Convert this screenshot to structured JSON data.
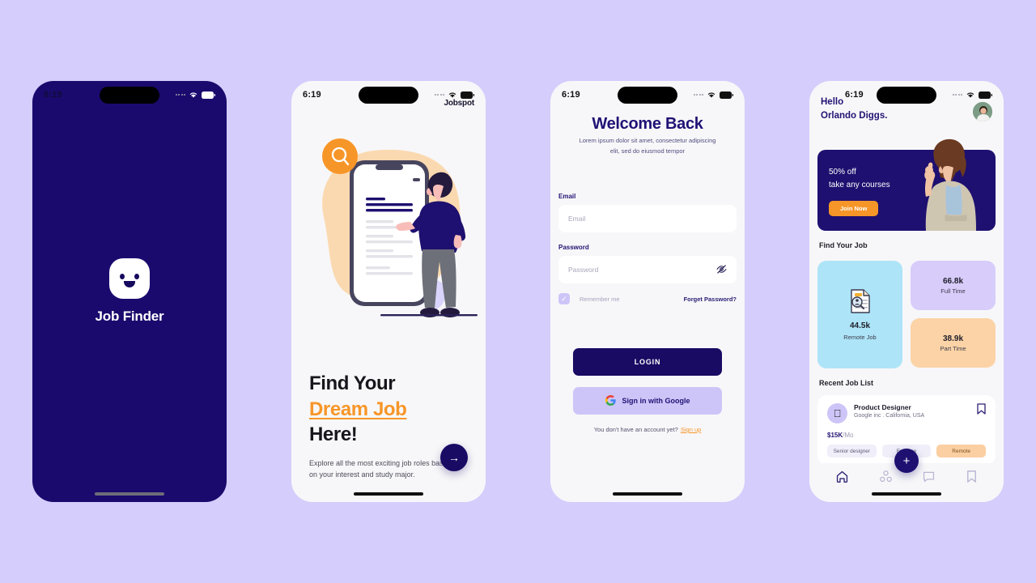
{
  "theme": {
    "page_bg": "#d5cdfb",
    "navy": "#190a64",
    "indigo": "#1e1070",
    "orange": "#f79628",
    "lavender": "#cdc5f7",
    "cyan": "#aee4f7",
    "peach": "#fbd3a6"
  },
  "splash": {
    "status_time": "6:19",
    "app_name": "Job Finder"
  },
  "onboarding": {
    "status_time": "6:19",
    "brand": "Jobspot",
    "heading_line1": "Find Your",
    "heading_accent": "Dream Job",
    "heading_line3": "Here!",
    "subtitle": "Explore all the most exciting job roles based on your interest and study major.",
    "next_label": "→"
  },
  "login": {
    "status_time": "6:19",
    "title": "Welcome Back",
    "subtitle": "Lorem ipsum dolor sit amet, consectetur adipiscing elit, sed do eiusmod tempor",
    "email_label": "Email",
    "email_placeholder": "Email",
    "email_value": "",
    "password_label": "Password",
    "password_placeholder": "Password",
    "password_value": "",
    "eye_icon": "eye-off-icon",
    "remember_label": "Remember me",
    "remember_checked": true,
    "forgot_label": "Forget Password?",
    "login_button": "LOGIN",
    "google_button": "Sign in with Google",
    "signup_prompt": "You don't have an account yet?",
    "signup_link": "Sign up"
  },
  "home": {
    "status_time": "6:19",
    "greeting": "Hello",
    "user_name": "Orlando Diggs.",
    "avatar": "user-avatar",
    "banner": {
      "line1": "50% off",
      "line2": "take any courses",
      "cta": "Join Now"
    },
    "find_job_heading": "Find Your Job",
    "stats": [
      {
        "value": "44.5k",
        "label": "Remote Job",
        "color": "#aee4f7",
        "icon": "document-search-icon"
      },
      {
        "value": "66.8k",
        "label": "Full Time",
        "color": "#d8ccfa"
      },
      {
        "value": "38.9k",
        "label": "Part Time",
        "color": "#fbd3a6"
      }
    ],
    "recent_heading": "Recent Job List",
    "jobs": [
      {
        "logo": "apple-icon",
        "title": "Product Designer",
        "meta": "Google inc . California, USA",
        "pay_amount": "$15K",
        "pay_period": "/Mo",
        "bookmark": "bookmark-icon",
        "tags": [
          "Senior designer",
          "Full time",
          "Remote"
        ]
      }
    ],
    "fab_label": "+",
    "nav": [
      {
        "name": "home",
        "icon": "home-icon",
        "active": true
      },
      {
        "name": "network",
        "icon": "network-icon",
        "active": false
      },
      {
        "name": "messages",
        "icon": "chat-icon",
        "active": false
      },
      {
        "name": "saved",
        "icon": "bookmark-icon",
        "active": false
      }
    ]
  }
}
